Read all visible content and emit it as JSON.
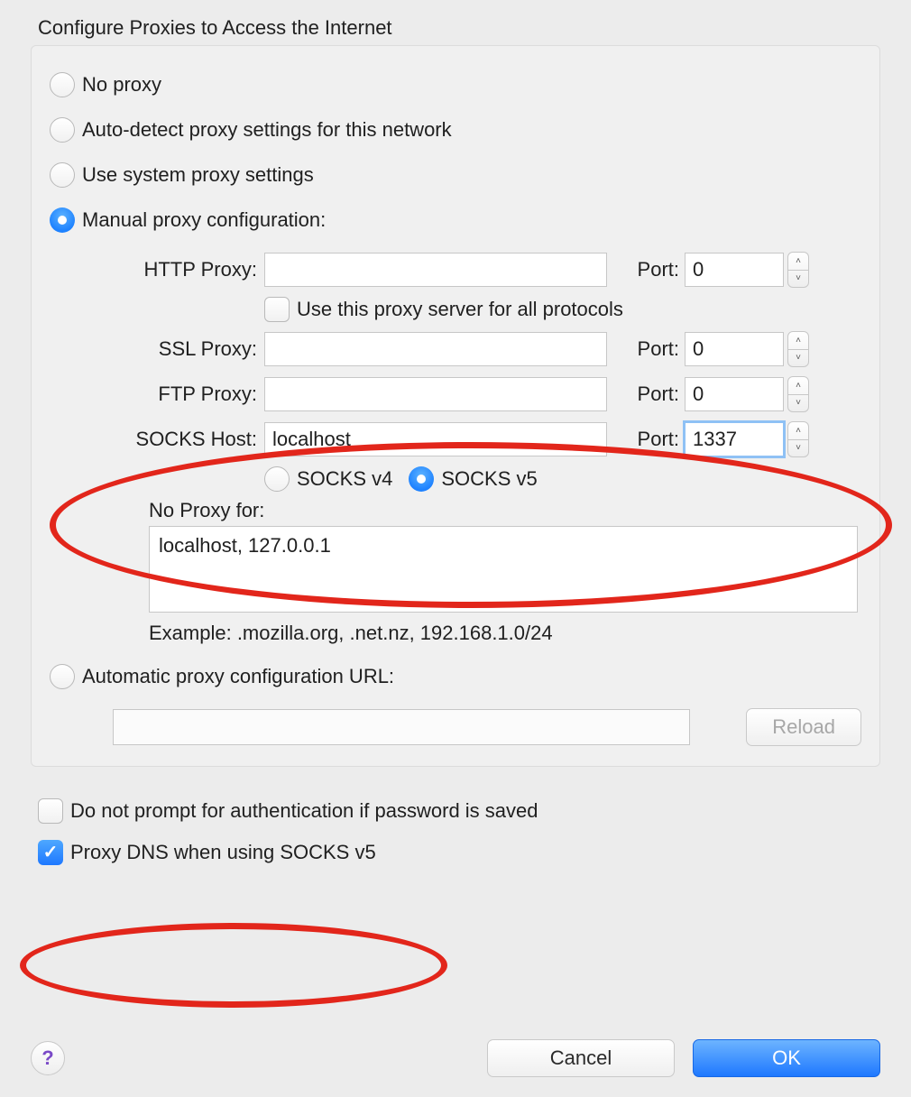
{
  "title": "Configure Proxies to Access the Internet",
  "radios": {
    "no_proxy": "No proxy",
    "auto_detect": "Auto-detect proxy settings for this network",
    "system": "Use system proxy settings",
    "manual": "Manual proxy configuration:",
    "auto_url": "Automatic proxy configuration URL:"
  },
  "labels": {
    "http_proxy": "HTTP Proxy:",
    "ssl_proxy": "SSL Proxy:",
    "ftp_proxy": "FTP Proxy:",
    "socks_host": "SOCKS Host:",
    "port": "Port:",
    "use_all": "Use this proxy server for all protocols",
    "socks_v4": "SOCKS v4",
    "socks_v5": "SOCKS v5",
    "no_proxy_for": "No Proxy for:",
    "example": "Example: .mozilla.org, .net.nz, 192.168.1.0/24",
    "reload": "Reload",
    "no_prompt": "Do not prompt for authentication if password is saved",
    "proxy_dns": "Proxy DNS when using SOCKS v5",
    "help": "?",
    "cancel": "Cancel",
    "ok": "OK"
  },
  "values": {
    "http_host": "",
    "http_port": "0",
    "ssl_host": "",
    "ssl_port": "0",
    "ftp_host": "",
    "ftp_port": "0",
    "socks_host": "localhost",
    "socks_port": "1337",
    "no_proxy_for": "localhost, 127.0.0.1",
    "auto_url": ""
  },
  "state": {
    "selected_radio": "manual",
    "use_all_checked": false,
    "socks_version": "v5",
    "no_prompt_checked": false,
    "proxy_dns_checked": true
  }
}
